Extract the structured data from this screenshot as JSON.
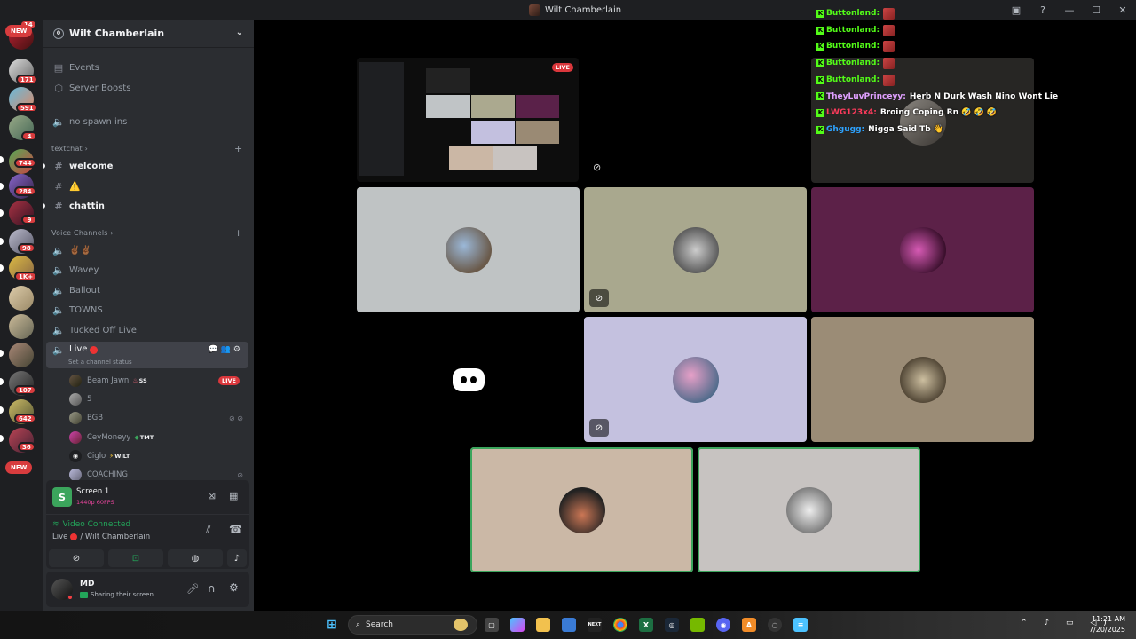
{
  "window": {
    "title": "Wilt Chamberlain"
  },
  "guilds": {
    "new_top": "NEW",
    "new_bottom": "NEW",
    "badges": [
      "14",
      "171",
      "591",
      "4",
      "744",
      "284",
      "9",
      "98",
      "1K+",
      "107",
      "642",
      "36"
    ]
  },
  "server": {
    "name": "Wilt Chamberlain",
    "icon_letter": "0"
  },
  "channels": {
    "events": "Events",
    "boosts": "Server Boosts",
    "no_spawn": "no spawn ins",
    "cat_text": "textchat",
    "welcome": "welcome",
    "alert_ch": "⚠️",
    "chattin": "chattin",
    "cat_voice": "Voice Channels",
    "hands": "✌🏾✌🏾",
    "wavey": "Wavey",
    "ballout": "Ballout",
    "towns": "TOWNS",
    "tucked": "Tucked Off Live",
    "live": "Live",
    "live_status": "Set a channel status"
  },
  "voice_users": [
    {
      "name": "Beam Jawn",
      "tag": "SS",
      "badge": "LIVE"
    },
    {
      "name": "5"
    },
    {
      "name": "BGB"
    },
    {
      "name": "CeyMoneyy",
      "tag": "TMT"
    },
    {
      "name": "Ciglo",
      "tag": "WILT"
    },
    {
      "name": "COACHING"
    }
  ],
  "screen_panel": {
    "title": "Screen 1",
    "sub": "1440p 60FPS"
  },
  "vc_panel": {
    "status": "Video Connected",
    "channel": "Live",
    "server": "/ Wilt Chamberlain"
  },
  "user_panel": {
    "name": "MD",
    "status": "Sharing their screen"
  },
  "stage": {
    "live_badge": "LIVE"
  },
  "chat": [
    {
      "user": "Buttonland:",
      "color": "#53fc18",
      "msg": ""
    },
    {
      "user": "Buttonland:",
      "color": "#53fc18",
      "msg": ""
    },
    {
      "user": "Buttonland:",
      "color": "#53fc18",
      "msg": ""
    },
    {
      "user": "Buttonland:",
      "color": "#53fc18",
      "msg": ""
    },
    {
      "user": "Buttonland:",
      "color": "#53fc18",
      "msg": ""
    },
    {
      "user": "TheyLuvPrinceyy:",
      "color": "#e0a0ff",
      "msg": "Herb N Durk Wash Nino Wont Lie"
    },
    {
      "user": "LWG123x4:",
      "color": "#ff3b5c",
      "msg": "Broing Coping Rn 🤣 🤣 🤣"
    },
    {
      "user": "Ghgugg:",
      "color": "#2ea3ff",
      "msg": "Nigga Said Tb 👋"
    }
  ],
  "taskbar": {
    "search": "Search",
    "time": "11:21 AM",
    "date": "7/20/2025"
  }
}
